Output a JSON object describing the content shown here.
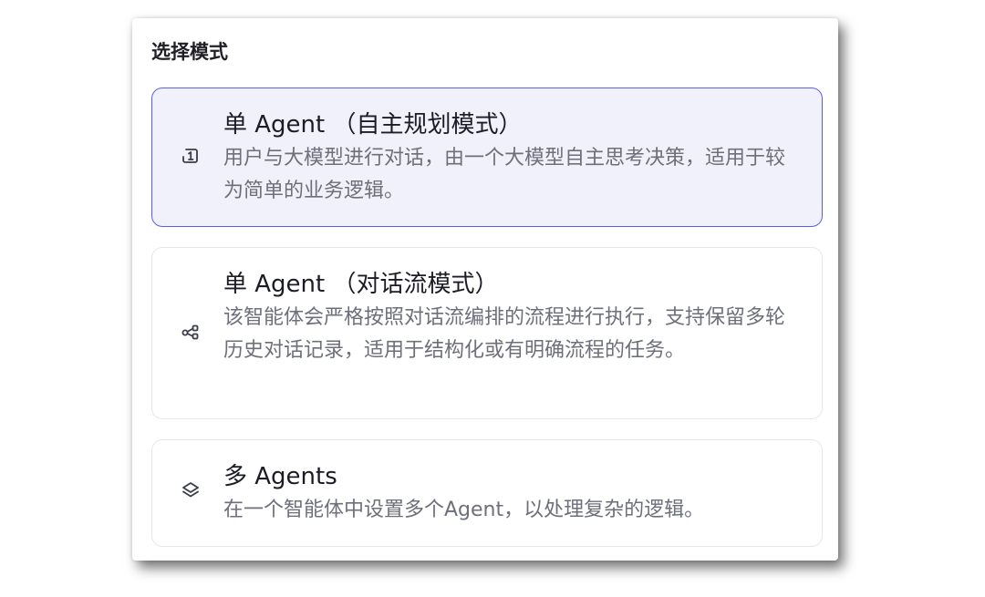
{
  "panel": {
    "title": "选择模式"
  },
  "options": [
    {
      "icon": "single-agent-icon",
      "title": "单 Agent （自主规划模式）",
      "description": "用户与大模型进行对话，由一个大模型自主思考决策，适用于较为简单的业务逻辑。",
      "selected": true
    },
    {
      "icon": "workflow-icon",
      "title": "单 Agent （对话流模式）",
      "description": "该智能体会严格按照对话流编排的流程进行执行，支持保留多轮历史对话记录，适用于结构化或有明确流程的任务。",
      "selected": false
    },
    {
      "icon": "layers-icon",
      "title": "多 Agents",
      "description": "在一个智能体中设置多个Agent，以处理复杂的逻辑。",
      "selected": false
    }
  ],
  "colors": {
    "selected_border": "#5a5fe6",
    "selected_background": "#f0f1fb",
    "card_border": "#e6e7ec",
    "title_text": "#1c1d24",
    "description_text": "#6d6f7b"
  }
}
